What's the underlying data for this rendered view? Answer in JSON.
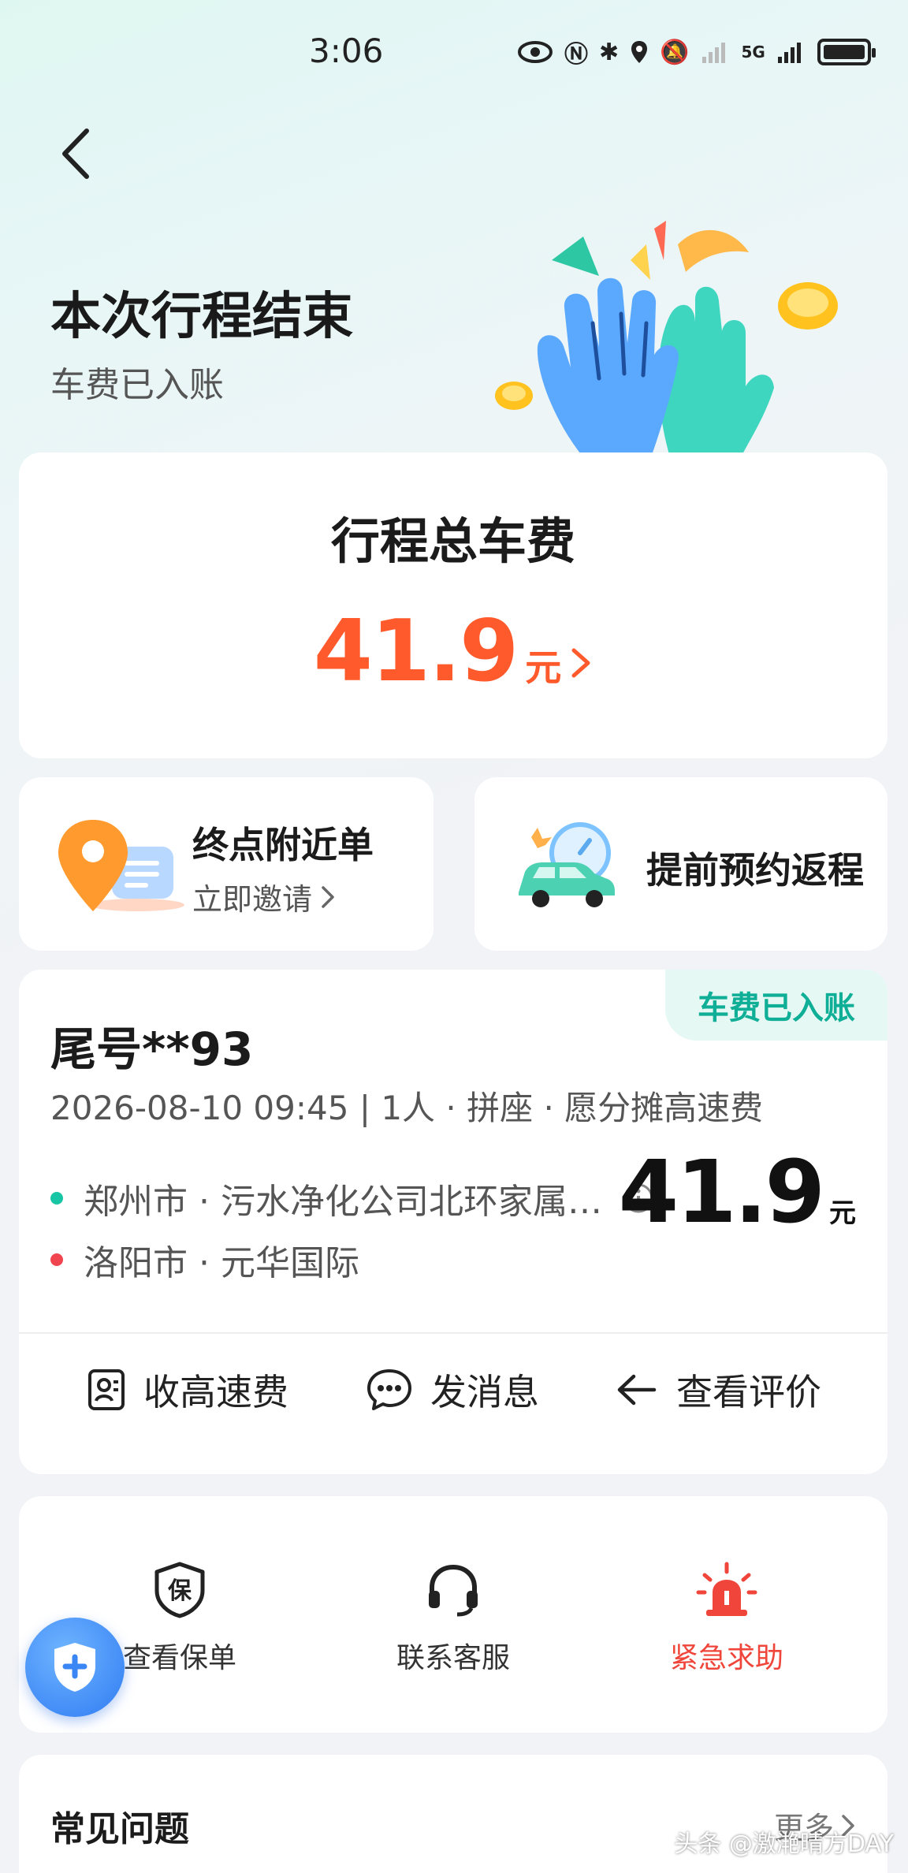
{
  "status_bar": {
    "time": "3:06",
    "network": "5G"
  },
  "header": {
    "title": "本次行程结束",
    "subtitle": "车费已入账"
  },
  "fare": {
    "label": "行程总车费",
    "amount": "41.9",
    "unit": "元"
  },
  "promos": [
    {
      "title": "终点附近单",
      "subtitle": "立即邀请"
    },
    {
      "title": "提前预约返程"
    }
  ],
  "trip": {
    "status_tag": "车费已入账",
    "plate": "尾号**93",
    "meta": "2026-08-10 09:45 | 1人 · 拼座 · 愿分摊高速费",
    "origin": "郑州市 · 污水净化公司北环家属…",
    "destination": "洛阳市 · 元华国际",
    "amount": "41.9",
    "unit": "元",
    "actions": [
      "收高速费",
      "发消息",
      "查看评价"
    ]
  },
  "services": [
    {
      "label": "查看保单",
      "icon_text": "保"
    },
    {
      "label": "联系客服"
    },
    {
      "label": "紧急求助"
    }
  ],
  "faq": {
    "title": "常见问题",
    "more": "更多"
  },
  "watermark": "头条 @激滟晴方DAY",
  "colors": {
    "accent_orange": "#ff5a2c",
    "accent_teal": "#0fae96",
    "danger_red": "#f0453a",
    "origin_dot": "#18c6a6",
    "dest_dot": "#f0454f"
  }
}
